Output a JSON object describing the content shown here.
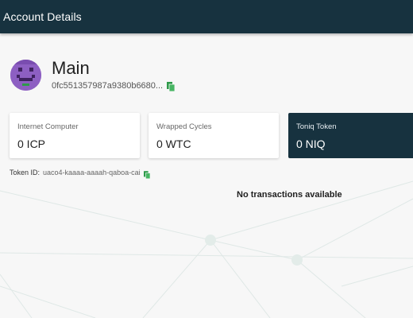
{
  "header": {
    "title": "Account Details"
  },
  "account": {
    "name": "Main",
    "address": "0fc551357987a9380b6680...",
    "avatar_icon": "pixel-face-icon",
    "copy_icon": "copy-icon"
  },
  "balances": [
    {
      "label": "Internet Computer",
      "value": "0 ICP",
      "selected": false
    },
    {
      "label": "Wrapped Cycles",
      "value": "0 WTC",
      "selected": false
    },
    {
      "label": "Toniq Token",
      "value": "0 NIQ",
      "selected": true
    }
  ],
  "token": {
    "key": "Token ID:",
    "value": "uaco4-kaaaa-aaaah-qaboa-cai"
  },
  "transactions": {
    "empty_text": "No transactions available"
  },
  "colors": {
    "header": "#17323f",
    "accent_green": "#2e9a4a",
    "avatar": "#8d5fc2",
    "background": "#f7f7f7"
  }
}
